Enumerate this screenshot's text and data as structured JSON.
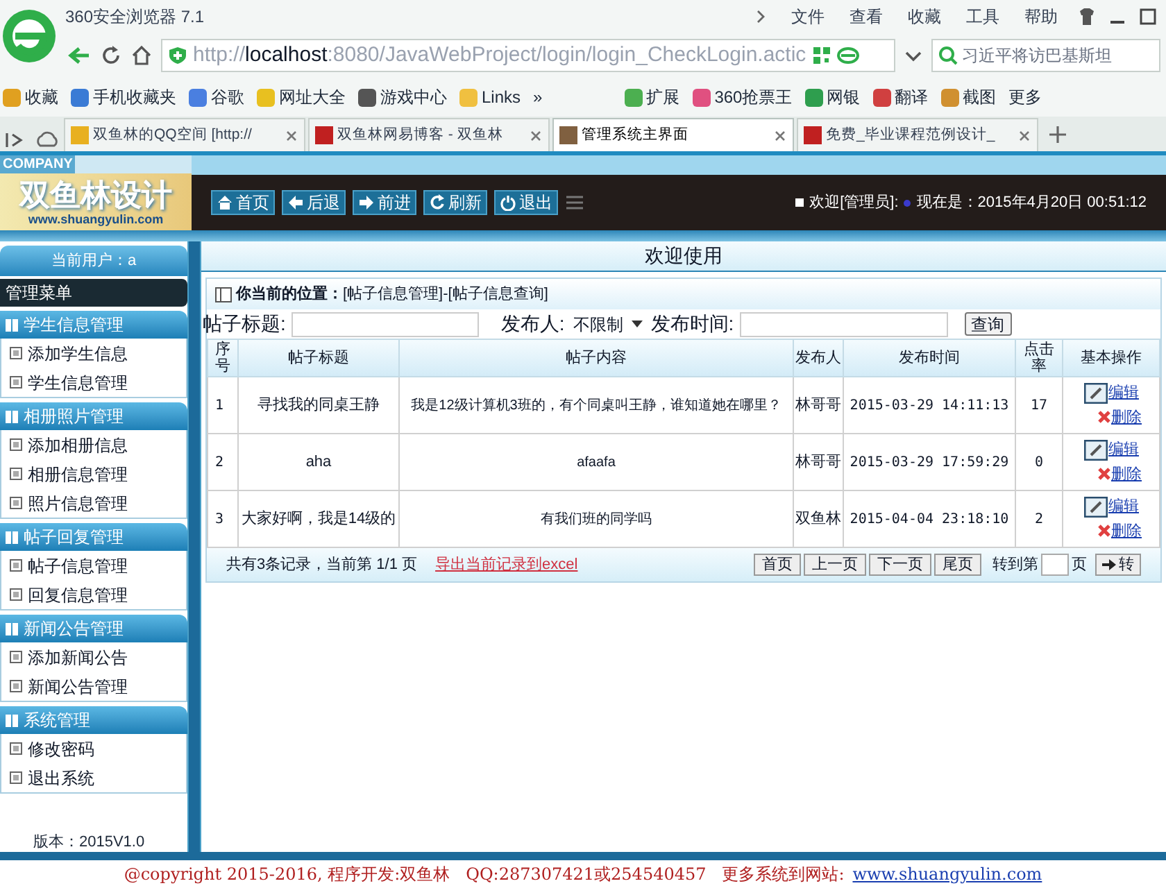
{
  "browser": {
    "title": "360安全浏览器 7.1",
    "menu": [
      "文件",
      "查看",
      "收藏",
      "工具",
      "帮助"
    ],
    "url_prefix": "http://",
    "url_host": "localhost",
    "url_rest": ":8080/JavaWebProject/login/login_CheckLogin.actic",
    "search": "习近平将访巴基斯坦",
    "bookmarks": [
      {
        "label": "收藏",
        "color": "#e0a020"
      },
      {
        "label": "手机收藏夹",
        "color": "#3a7bd5"
      },
      {
        "label": "谷歌",
        "color": "#4a7fe0"
      },
      {
        "label": "网址大全",
        "color": "#e8c020"
      },
      {
        "label": "游戏中心",
        "color": "#555555"
      },
      {
        "label": "Links",
        "color": "#f0c040"
      },
      {
        "label": "»"
      },
      {
        "label": "扩展",
        "color": "#4caf50"
      },
      {
        "label": "360抢票王",
        "color": "#e05080"
      },
      {
        "label": "网银",
        "color": "#2e9e4e"
      },
      {
        "label": "翻译",
        "color": "#d04040"
      },
      {
        "label": "截图",
        "color": "#d09030"
      },
      {
        "label": "更多"
      }
    ],
    "tabs": [
      {
        "label": "双鱼林的QQ空间 [http://",
        "selected": false,
        "color": "#e8b020"
      },
      {
        "label": "双鱼林网易博客 - 双鱼林",
        "selected": false,
        "color": "#c02020"
      },
      {
        "label": "管理系统主界面",
        "selected": true,
        "color": "#806040"
      },
      {
        "label": "免费_毕业课程范例设计_",
        "selected": false,
        "color": "#c02020"
      }
    ]
  },
  "header": {
    "company": "COMPANY",
    "logo": "双鱼林设计",
    "site": "www.shuangyulin.com",
    "nav": [
      {
        "label": "首页",
        "kind": "home"
      },
      {
        "label": "后退",
        "kind": "back"
      },
      {
        "label": "前进",
        "kind": "forward"
      },
      {
        "label": "刷新",
        "kind": "refresh"
      },
      {
        "label": "退出",
        "kind": "power"
      }
    ],
    "welcome": "欢迎[管理员]:",
    "time": "现在是：2015年4月20日 00:51:12"
  },
  "sidebar": {
    "user": "当前用户：a",
    "menu_title": "管理菜单",
    "groups": [
      {
        "title": "学生信息管理",
        "items": [
          "添加学生信息",
          "学生信息管理"
        ]
      },
      {
        "title": "相册照片管理",
        "items": [
          "添加相册信息",
          "相册信息管理",
          "照片信息管理"
        ]
      },
      {
        "title": "帖子回复管理",
        "items": [
          "帖子信息管理",
          "回复信息管理"
        ]
      },
      {
        "title": "新闻公告管理",
        "items": [
          "添加新闻公告",
          "新闻公告管理"
        ]
      },
      {
        "title": "系统管理",
        "items": [
          "修改密码",
          "退出系统"
        ]
      }
    ],
    "version": "版本：2015V1.0"
  },
  "main": {
    "title": "欢迎使用",
    "location_label": "你当前的位置：",
    "location": "[帖子信息管理]-[帖子信息查询]",
    "search": {
      "title_label": "帖子标题:",
      "author_label": "发布人:",
      "author_value": "不限制",
      "time_label": "发布时间:",
      "button": "查询"
    },
    "table": {
      "columns": [
        "序号",
        "帖子标题",
        "帖子内容",
        "发布人",
        "发布时间",
        "点击率",
        "基本操作"
      ],
      "rows": [
        {
          "cells": [
            "1",
            "寻找我的同桌王静",
            "我是12级计算机3班的，有个同桌叫王静，谁知道她在哪里？",
            "林哥哥",
            "2015-03-29 14:11:13",
            "17"
          ],
          "actions": [
            "编辑",
            "删除"
          ]
        },
        {
          "cells": [
            "2",
            "aha",
            "afaafa",
            "林哥哥",
            "2015-03-29 17:59:29",
            "0"
          ],
          "actions": [
            "编辑",
            "删除"
          ]
        },
        {
          "cells": [
            "3",
            "大家好啊，我是14级的",
            "有我们班的同学吗",
            "双鱼林",
            "2015-04-04 23:18:10",
            "2"
          ],
          "actions": [
            "编辑",
            "删除"
          ]
        }
      ]
    },
    "pager": {
      "summary": "共有3条记录，当前第 1/1 页",
      "export": "导出当前记录到excel",
      "buttons": [
        "首页",
        "上一页",
        "下一页",
        "尾页"
      ],
      "goto_label": "转到第",
      "page_label": "页",
      "go": "转"
    }
  },
  "footer": {
    "text": "@copyright 2015-2016, 程序开发:双鱼林   QQ:287307421或254540457   更多系统到网站:",
    "link": "www.shuangyulin.com"
  }
}
